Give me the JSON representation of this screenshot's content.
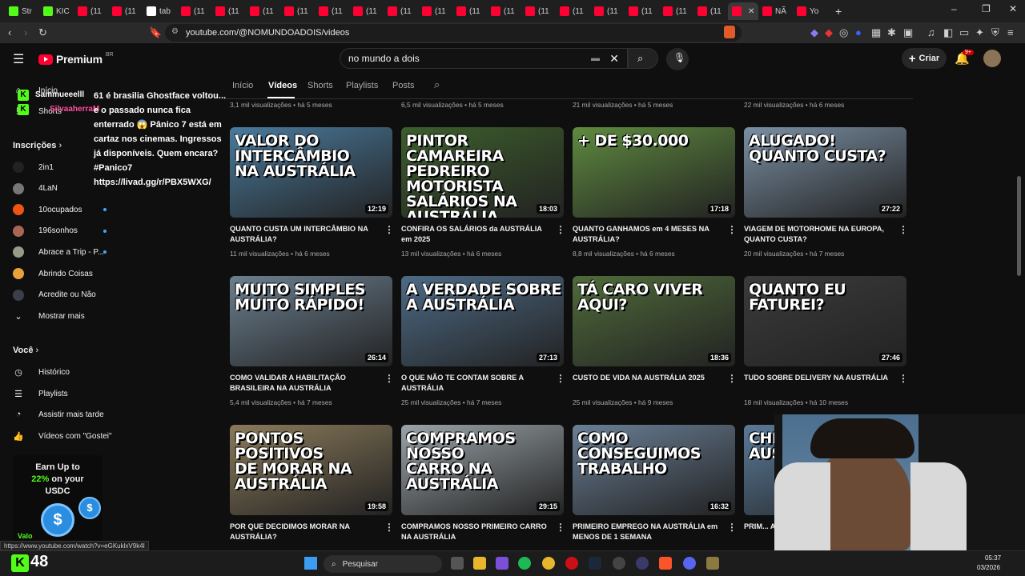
{
  "browser": {
    "tabs": [
      "Str",
      "KIC",
      "(11",
      "(11",
      "tab",
      "(11",
      "(11",
      "(11",
      "(11",
      "(11",
      "(11",
      "(11",
      "(11",
      "(11",
      "(11",
      "(11",
      "(11",
      "(11",
      "(11",
      "(11",
      "(11",
      "",
      "NÃ",
      "Yo"
    ],
    "url": "youtube.com/@NOMUNDOADOIS/videos",
    "window_controls": [
      "–",
      "❐",
      "✕"
    ]
  },
  "yt": {
    "brand": "Premium",
    "region": "BR",
    "search_value": "no mundo a dois",
    "create_label": "Criar",
    "notif_count": "9+"
  },
  "channel_tabs": [
    "Início",
    "Vídeos",
    "Shorts",
    "Playlists",
    "Posts"
  ],
  "sidebar": {
    "top": [
      "Início",
      "Shorts"
    ],
    "subs_header": "Inscrições",
    "subs": [
      {
        "label": "2in1",
        "dot": false
      },
      {
        "label": "4LaN",
        "dot": false
      },
      {
        "label": "10ocupados",
        "dot": true
      },
      {
        "label": "196sonhos",
        "dot": true
      },
      {
        "label": "Abrace a Trip - P...",
        "dot": true
      },
      {
        "label": "Abrindo Coisas",
        "dot": false
      },
      {
        "label": "Acredite ou Não",
        "dot": false
      },
      {
        "label": "Mostrar mais",
        "dot": false
      }
    ],
    "you_header": "Você",
    "you": [
      "Histórico",
      "Playlists",
      "Assistir mais tarde",
      "Vídeos com \"Gostei\""
    ]
  },
  "overlay": {
    "chat_user": "Sammueeelll",
    "chat_user2": "SilvaaherraM",
    "chat_text": "61 é brasilia Ghostface voltou... e o passado nunca fica enterrado 😱 Pânico 7 está em cartaz nos cinemas. Ingressos já disponíveis. Quem encara? #Panico7 https://livad.gg/r/PBX5WXG/",
    "ad_line1": "Earn Up to",
    "ad_line2": "22%",
    "ad_line3": "on your",
    "ad_line4": "USDC",
    "ad_brand": "Valo",
    "kick_count": "48",
    "status_url": "https://www.youtube.com/watch?v=eGKuklxV9k4I"
  },
  "top_meta": [
    "3,1 mil visualizações • há 5 meses",
    "6,5 mil visualizações • há 5 meses",
    "21 mil visualizações • há 5 meses",
    "22 mil visualizações • há 6 meses"
  ],
  "videos": [
    {
      "title": "QUANTO CUSTA UM INTERCÂMBIO NA AUSTRÁLIA?",
      "meta": "11 mil visualizações • há 6 meses",
      "duration": "12:19",
      "overlay": "VALOR DO\nINTERCÂMBIO\nNA AUSTRÁLIA",
      "bg": "#4a7a9c"
    },
    {
      "title": "CONFIRA OS SALÁRIOS da AUSTRÁLIA em 2025",
      "meta": "13 mil visualizações • há 6 meses",
      "duration": "18:03",
      "overlay": "PINTOR\nCAMAREIRA\nPEDREIRO\nMOTORISTA\nSALÁRIOS NA AUSTRÁLIA",
      "bg": "#3d5e2c"
    },
    {
      "title": "QUANTO GANHAMOS em 4 MESES NA AUSTRÁLIA?",
      "meta": "8,8 mil visualizações • há 6 meses",
      "duration": "17:18",
      "overlay": "+ DE $30.000",
      "bg": "#5f8a3f"
    },
    {
      "title": "VIAGEM DE MOTORHOME NA EUROPA, QUANTO CUSTA?",
      "meta": "20 mil visualizações • há 7 meses",
      "duration": "27:22",
      "overlay": "ALUGADO!\nQUANTO CUSTA?",
      "bg": "#7a8fa3"
    },
    {
      "title": "COMO VALIDAR A HABILITAÇÃO BRASILEIRA NA AUSTRÁLIA",
      "meta": "5,4 mil visualizações • há 7 meses",
      "duration": "26:14",
      "overlay": "MUITO SIMPLES\nMUITO RÁPIDO!",
      "bg": "#6b7f8f"
    },
    {
      "title": "O QUE NÃO TE CONTAM SOBRE A AUSTRÁLIA",
      "meta": "25 mil visualizações • há 7 meses",
      "duration": "27:13",
      "overlay": "A VERDADE SOBRE\nA AUSTRÁLIA",
      "bg": "#4d6a85"
    },
    {
      "title": "CUSTO DE VIDA NA AUSTRÁLIA 2025",
      "meta": "25 mil visualizações • há 9 meses",
      "duration": "18:36",
      "overlay": "TÁ CARO VIVER AQUI?",
      "bg": "#4f6b3a"
    },
    {
      "title": "TUDO SOBRE DELIVERY NA AUSTRÁLIA",
      "meta": "18 mil visualizações • há 10 meses",
      "duration": "27:46",
      "overlay": "QUANTO EU\nFATUREI?",
      "bg": "#3b3b3b"
    },
    {
      "title": "POR QUE DECIDIMOS MORAR NA AUSTRÁLIA?",
      "meta": "",
      "duration": "19:58",
      "overlay": "PONTOS POSITIVOS\nDE MORAR NA AUSTRÁLIA",
      "bg": "#8a7a5a"
    },
    {
      "title": "COMPRAMOS NOSSO PRIMEIRO CARRO NA AUSTRÁLIA",
      "meta": "",
      "duration": "29:15",
      "overlay": "COMPRAMOS NOSSO\nCARRO NA AUSTRÁLIA",
      "bg": "#9aa3a8"
    },
    {
      "title": "PRIMEIRO EMPREGO NA AUSTRÁLIA em MENOS DE 1 SEMANA",
      "meta": "",
      "duration": "16:32",
      "overlay": "COMO CONSEGUIMOS\nTRABALHO",
      "bg": "#6a7f96"
    },
    {
      "title": "PRIM... AU...",
      "meta": "",
      "duration": "",
      "overlay": "CHEGAMO\nAUST",
      "bg": "#5a7a99"
    }
  ],
  "taskbar": {
    "search_label": "Pesquisar",
    "time": "05:37",
    "date": "03/2026"
  },
  "colors": {
    "accent": "#3ea6ff",
    "brand_red": "#ff0033",
    "kick_green": "#53fc18"
  }
}
